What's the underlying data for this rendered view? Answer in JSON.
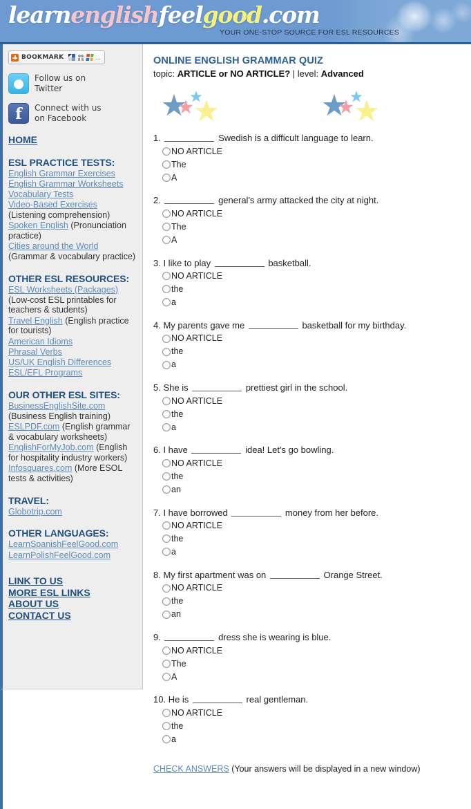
{
  "header": {
    "logo_parts": [
      {
        "text": "learn",
        "color_class": "w"
      },
      {
        "text": "english",
        "color_class": "p"
      },
      {
        "text": "feel",
        "color_class": "w"
      },
      {
        "text": "good",
        "color_class": "y"
      },
      {
        "text": ".com",
        "color_class": "w"
      }
    ],
    "logo_text": "learnenglishfeelgood.com",
    "tagline": "YOUR ONE-STOP SOURCE FOR ESL RESOURCES",
    "brand_blue": "#6d9bd1",
    "brand_pink": "#f7c4cc",
    "brand_yellow": "#f6f07c"
  },
  "sidebar": {
    "bookmark": {
      "label": "BOOKMARK",
      "more": "..."
    },
    "social": [
      {
        "icon": "twitter-icon",
        "line1": "Follow us on",
        "line2": "Twitter"
      },
      {
        "icon": "facebook-icon",
        "line1": "Connect with us",
        "line2": "on Facebook"
      }
    ],
    "home_label": "HOME",
    "sections": [
      {
        "heading": "ESL PRACTICE TESTS:",
        "items": [
          {
            "link": "English Grammar Exercises",
            "note": ""
          },
          {
            "link": "English Grammar Worksheets",
            "note": ""
          },
          {
            "link": "Vocabulary Tests",
            "note": ""
          },
          {
            "link": "Video-Based Exercises",
            "note": " (Listening comprehension)"
          },
          {
            "link": "Spoken English",
            "note": " (Pronunciation practice)"
          },
          {
            "link": "Cities around the World",
            "note": " (Grammar & vocabulary practice)"
          }
        ]
      },
      {
        "heading": "OTHER ESL RESOURCES:",
        "items": [
          {
            "link": "ESL Worksheets (Packages)",
            "note": " (Low-cost ESL printables for teachers & students)"
          },
          {
            "link": "Travel English",
            "note": " (English practice for tourists)"
          },
          {
            "link": "American Idioms",
            "note": ""
          },
          {
            "link": "Phrasal Verbs",
            "note": ""
          },
          {
            "link": "US/UK English Differences",
            "note": ""
          },
          {
            "link": "ESL/EFL Programs",
            "note": ""
          }
        ]
      },
      {
        "heading": "OUR OTHER ESL SITES:",
        "items": [
          {
            "link": "BusinessEnglishSite.com",
            "note": " (Business English training)"
          },
          {
            "link": "ESLPDF.com",
            "note": " (English grammar & vocabulary worksheets)"
          },
          {
            "link": "EnglishForMyJob.com",
            "note": " (English for hospitality industry workers)"
          },
          {
            "link": "Infosquares.com",
            "note": " (More ESOL tests & activities)"
          }
        ]
      },
      {
        "heading": "TRAVEL:",
        "items": [
          {
            "link": "Globotrip.com",
            "note": ""
          }
        ]
      },
      {
        "heading": "OTHER LANGUAGES:",
        "items": [
          {
            "link": "LearnSpanishFeelGood.com",
            "note": ""
          },
          {
            "link": "LearnPolishFeelGood.com",
            "note": ""
          }
        ]
      }
    ],
    "bottom_links": [
      "LINK TO US",
      "MORE ESL LINKS",
      "ABOUT US",
      "CONTACT US"
    ]
  },
  "main": {
    "title": "ONLINE ENGLISH GRAMMAR QUIZ",
    "topic_prefix": "topic: ",
    "topic": "ARTICLE or NO ARTICLE?",
    "separator": " | ",
    "level_prefix": "level: ",
    "level": "Advanced",
    "stars": {
      "colors": [
        "#6e9cc9",
        "#f59ea4",
        "#7dc8ef",
        "#faf08f"
      ],
      "cluster_count": 2
    },
    "questions": [
      {
        "number": "1.",
        "before": "",
        "after": " Swedish is a difficult language to learn.",
        "options": [
          "NO ARTICLE",
          "The",
          "A"
        ]
      },
      {
        "number": "2.",
        "before": "",
        "after": " general's army attacked the city at night.",
        "options": [
          "NO ARTICLE",
          "The",
          "A"
        ]
      },
      {
        "number": "3.",
        "before": " I like to play ",
        "after": " basketball.",
        "options": [
          "NO ARTICLE",
          "the",
          "a"
        ]
      },
      {
        "number": "4.",
        "before": " My parents gave me ",
        "after": " basketball for my birthday.",
        "options": [
          "NO ARTICLE",
          "the",
          "a"
        ]
      },
      {
        "number": "5.",
        "before": " She is ",
        "after": " prettiest girl in the school.",
        "options": [
          "NO ARTICLE",
          "the",
          "a"
        ]
      },
      {
        "number": "6.",
        "before": " I have ",
        "after": " idea! Let's go bowling.",
        "options": [
          "NO ARTICLE",
          "the",
          "an"
        ]
      },
      {
        "number": "7.",
        "before": " I have borrowed ",
        "after": " money from her before.",
        "options": [
          "NO ARTICLE",
          "the",
          "a"
        ]
      },
      {
        "number": "8.",
        "before": " My first apartment was on ",
        "after": " Orange Street.",
        "options": [
          "NO ARTICLE",
          "the",
          "an"
        ]
      },
      {
        "number": "9.",
        "before": "",
        "after": " dress she is wearing is blue.",
        "options": [
          "NO ARTICLE",
          "The",
          "A"
        ]
      },
      {
        "number": "10.",
        "before": " He is ",
        "after": " real gentleman.",
        "options": [
          "NO ARTICLE",
          "the",
          "a"
        ]
      }
    ],
    "footer": {
      "link": "CHECK ANSWERS",
      "note": " (Your answers will be displayed in a new window)"
    }
  }
}
